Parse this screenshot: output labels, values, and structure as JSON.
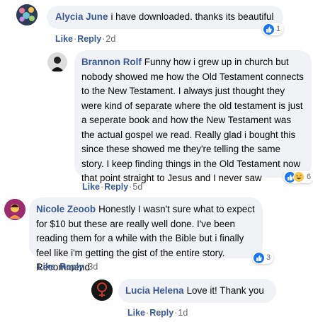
{
  "actions": {
    "like": "Like",
    "reply": "Reply",
    "separator": "·"
  },
  "colors": {
    "author": "#385898",
    "bubble": "#f0f2f5",
    "like_reaction": "#1877f2",
    "haha_reaction": "#f7c84b"
  },
  "comments": [
    {
      "author": "Alycia June",
      "text": "i have downloaded. thanks its beautiful",
      "time": "2d",
      "reactions": [
        "like-icon"
      ],
      "reaction_count": "1"
    },
    {
      "author": "Brannon Rolf",
      "text": "Funny how i grew up in church but nobody showed me how the Old Testament connects to the New Testament. I always just thought they were kind of separate where the old testament is just a seperate book and how the New Testament was the actual gospel we read. Really glad i bought this since these  showed me they're telling the same story. I keep finding things in the Old Testament now that point straight to Jesus and I never saw",
      "time": "5d",
      "reactions": [
        "like-icon",
        "haha-icon"
      ],
      "reaction_count": "6"
    },
    {
      "author": "Nicole Zeoob",
      "text": "Honestly I wasn't sure what to expect for $10 but these are really well done. I've been reading them for a while with the Bible but i finally feel like i'm getting the gist of the entire story. Recommend",
      "time": "3d",
      "reactions": [
        "like-icon"
      ],
      "reaction_count": "3"
    },
    {
      "author": "Lucia Helena",
      "text": "Love it! Thank you",
      "time": "1d",
      "reactions": [],
      "reaction_count": ""
    }
  ]
}
